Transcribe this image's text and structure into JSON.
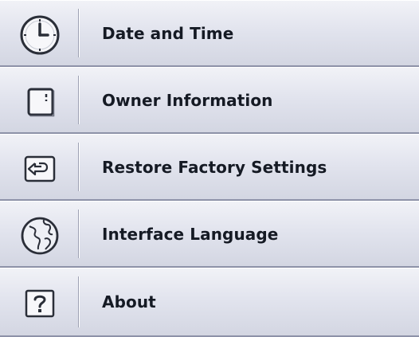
{
  "menu": {
    "items": [
      {
        "label": "Date and Time",
        "icon": "clock-icon"
      },
      {
        "label": "Owner Information",
        "icon": "document-icon"
      },
      {
        "label": "Restore Factory Settings",
        "icon": "restore-icon"
      },
      {
        "label": "Interface Language",
        "icon": "globe-icon"
      },
      {
        "label": "About",
        "icon": "question-icon"
      }
    ]
  },
  "colors": {
    "text": "#151a24",
    "icon_stroke": "#2a2e38",
    "row_light": "#f1f2f7",
    "row_dark": "#d3d6e2"
  }
}
